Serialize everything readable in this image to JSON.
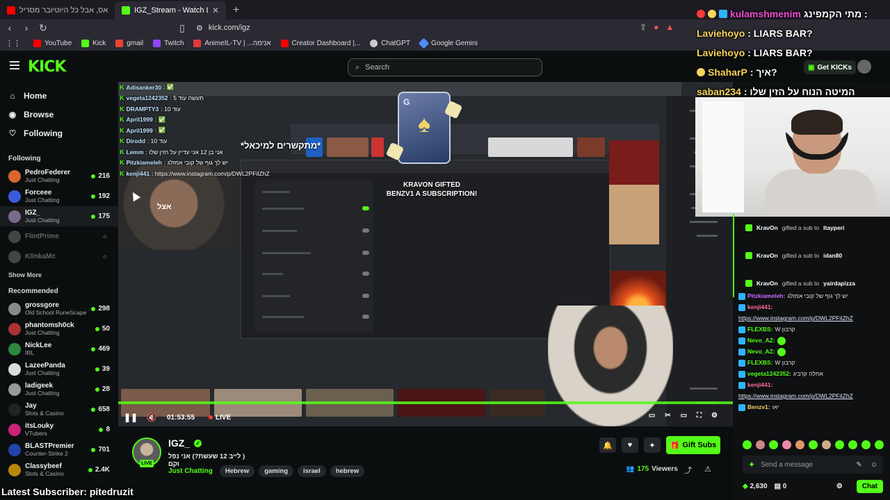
{
  "browser": {
    "tabs": [
      {
        "label": "אמונגג אס, אבל כל היוטיובר מסריל",
        "color": "#ff0000",
        "active": false
      },
      {
        "label": "IGZ_Stream - Watch Live on Kick",
        "color": "#53fc18",
        "active": true
      }
    ],
    "url": "kick.com/igz",
    "bookmarks": [
      {
        "label": "YouTube",
        "color": "#ff0000"
      },
      {
        "label": "Kick",
        "color": "#53fc18"
      },
      {
        "label": "gmail",
        "color": "#ea4335"
      },
      {
        "label": "Twitch",
        "color": "#9146ff"
      },
      {
        "label": "AnimeIL-TV | ...אנימה",
        "color": "#e23a3a"
      },
      {
        "label": "Creator Dashboard |...",
        "color": "#ff0000"
      },
      {
        "label": "ChatGPT",
        "color": "#cccccc"
      },
      {
        "label": "Google Gemini",
        "color": "#4f8cff"
      }
    ]
  },
  "header": {
    "logo": "KICK",
    "search_placeholder": "Search",
    "get_kicks": "Get KICKs"
  },
  "sidebar": {
    "menu": [
      {
        "label": "Home",
        "icon": "home-icon"
      },
      {
        "label": "Browse",
        "icon": "compass-icon"
      },
      {
        "label": "Following",
        "icon": "heart-icon"
      }
    ],
    "following_title": "Following",
    "following": [
      {
        "name": "PedroFederer",
        "category": "Just Chatting",
        "viewers": "216",
        "color": "#d9662f",
        "online": true
      },
      {
        "name": "Forceee",
        "category": "Just Chatting",
        "viewers": "192",
        "color": "#3b5bdb",
        "online": true
      },
      {
        "name": "IGZ_",
        "category": "Just Chatting",
        "viewers": "175",
        "color": "#7b6a8c",
        "online": true
      },
      {
        "name": "FlintPrime",
        "category": "",
        "viewers": "",
        "color": "#444444",
        "online": false
      },
      {
        "name": "K0nkaMc",
        "category": "",
        "viewers": "",
        "color": "#444444",
        "online": false
      }
    ],
    "show_more": "Show More",
    "recommended_title": "Recommended",
    "recommended": [
      {
        "name": "grossgore",
        "category": "Old School RuneScape",
        "viewers": "298",
        "color": "#8a8a8a"
      },
      {
        "name": "phantomsh0ck",
        "category": "Just Chatting",
        "viewers": "50",
        "color": "#a33"
      },
      {
        "name": "NickLee",
        "category": "IRL",
        "viewers": "469",
        "color": "#2b8a3e"
      },
      {
        "name": "LazeePanda",
        "category": "Just Chatting",
        "viewers": "39",
        "color": "#ddd"
      },
      {
        "name": "ladigeek",
        "category": "Just Chatting",
        "viewers": "28",
        "color": "#999"
      },
      {
        "name": "Jay",
        "category": "Slots & Casino",
        "viewers": "658",
        "color": "#222"
      },
      {
        "name": "itsLouky",
        "category": "VTubers",
        "viewers": "8",
        "color": "#c27"
      },
      {
        "name": "BLASTPremier",
        "category": "Counter-Strike 2",
        "viewers": "701",
        "color": "#2244aa"
      },
      {
        "name": "Classybeef",
        "category": "Slots & Casino",
        "viewers": "2.4K",
        "color": "#b8860b"
      }
    ]
  },
  "player": {
    "overlay_chat": [
      {
        "user": "Adisanker30",
        "text": ": ✅"
      },
      {
        "user": "vegeta1242352",
        "text": ": 5 תעשה עוד"
      },
      {
        "user": "DRAMPTY3",
        "text": ": 10 עוד"
      },
      {
        "user": "April1999",
        "text": ": ✅"
      },
      {
        "user": "April1999",
        "text": ": ✅"
      },
      {
        "user": "Dirodd",
        "text": ": 10 עוד"
      },
      {
        "user": "Lemm",
        "text": ": אני בן 12 אני עדיין על הזין שלו"
      },
      {
        "user": "Pitzkiameleh",
        "text": ": יש לך גוף של קובי אמזלג"
      },
      {
        "user": "kenji441",
        "text": ": https://www.instagram.com/p/DWL2PFiIZhZ"
      }
    ],
    "heb_title": "*מתקשרים למיכאל*",
    "streamer_label": "אצל",
    "gift_alert_line1": "KRAVON GIFTED",
    "gift_alert_line2": "BENZV1 A SUBSCRIPTION!",
    "time": "01:53:55",
    "live": "LIVE",
    "progress_percent": 100
  },
  "channel": {
    "name": "IGZ_",
    "live_badge": "LIVE",
    "title": "( לייב 12 שעשת?) אני נפל וקם",
    "category": "Just Chatting",
    "tags": [
      "Hebrew",
      "gaming",
      "israel",
      "hebrew"
    ],
    "gift_subs": "Gift Subs",
    "viewers": "175",
    "viewers_label": "Viewers"
  },
  "overlay_top_chat": [
    {
      "user": "kulamshmenim",
      "text": "מתי הקמפינג :",
      "cls": "nm"
    },
    {
      "user": "Laviehoyo",
      "text": ": LIARS BAR?",
      "cls": "nm2"
    },
    {
      "user": "Laviehoyo",
      "text": ": LIARS BAR?",
      "cls": "nm2"
    },
    {
      "user": "ShaharP",
      "text": ": איך?",
      "cls": "nm2"
    },
    {
      "user": "saban234",
      "text": ": המיטה הנוח על הזין שלו",
      "cls": "nm2"
    }
  ],
  "subs": [
    {
      "user": "KravOn",
      "text": "gifted a sub to",
      "target": "Itayperi"
    },
    {
      "user": "KravOn",
      "text": "gifted a sub to",
      "target": "idan80"
    },
    {
      "user": "KravOn",
      "text": "gifted a sub to",
      "target": "yairdapizza"
    }
  ],
  "chat": [
    {
      "user": "Pitzkiameleh:",
      "text": "יש לך גוף של קובי אמזלג",
      "color": "#d06bff",
      "link": ""
    },
    {
      "user": "kenji441:",
      "text": "",
      "color": "#ff6b9a",
      "link": "https://www.instagram.com/p/DWL2PFiIZhZ"
    },
    {
      "user": "FLEXBS:",
      "text": "W קרבון",
      "color": "#53fc18",
      "link": ""
    },
    {
      "user": "Nevo_AZ:",
      "text": "",
      "color": "#53fc18",
      "link": ""
    },
    {
      "user": "Nevo_AZ:",
      "text": "",
      "color": "#53fc18",
      "link": ""
    },
    {
      "user": "FLEXBS:",
      "text": "W קרבון",
      "color": "#53fc18",
      "link": ""
    },
    {
      "user": "vegeta1242352:",
      "text": "אחלה קרביג",
      "color": "#53fc18",
      "link": ""
    },
    {
      "user": "kenji441:",
      "text": "",
      "color": "#ff6b9a",
      "link": "https://www.instagram.com/p/DWL2PFiIZhZ"
    },
    {
      "user": "Benzv1:",
      "text": "יאו",
      "color": "#f5d061",
      "link": ""
    }
  ],
  "chat_input": {
    "placeholder": "Send a message",
    "kicks": "2,630",
    "count": "0",
    "chat_button": "Chat"
  },
  "latest_sub": "Latest Subscriber: pitedruzit"
}
